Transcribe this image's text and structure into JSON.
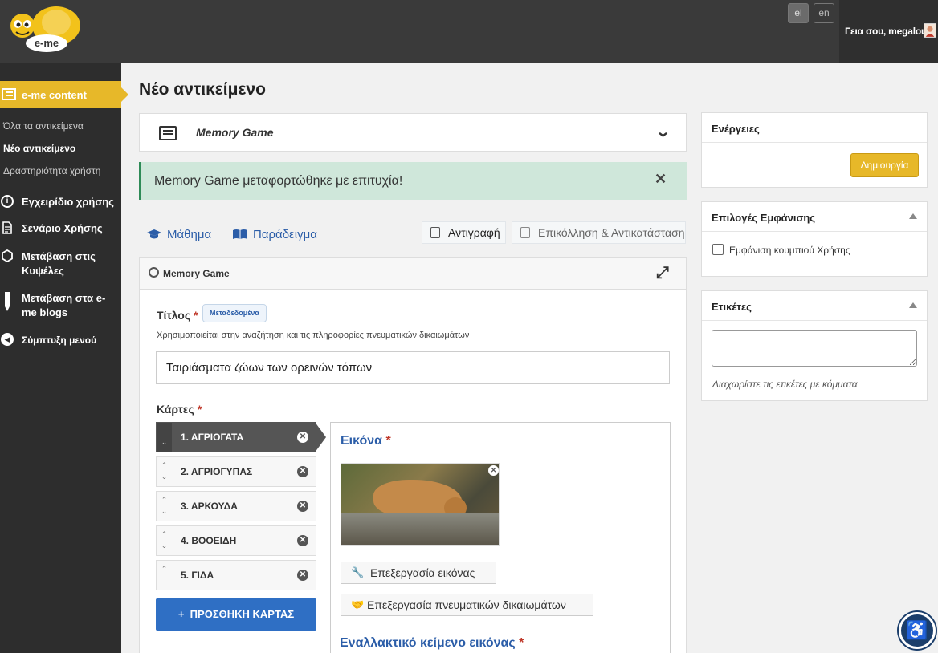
{
  "header": {
    "logo_text": "e-me",
    "lang_el": "el",
    "lang_en": "en",
    "greeting": "Γεια σου, megalou"
  },
  "sidebar": {
    "active_section": "e-me content",
    "sub_items": [
      {
        "label": "Όλα τα αντικείμενα"
      },
      {
        "label": "Νέο αντικείμενο"
      },
      {
        "label": "Δραστηριότητα χρήστη"
      }
    ],
    "items": [
      {
        "label": "Εγχειρίδιο χρήσης"
      },
      {
        "label": "Σενάριο Χρήσης"
      },
      {
        "label": "Μετάβαση στις Κυψέλες"
      },
      {
        "label": "Μετάβαση στα e-me blogs"
      },
      {
        "label": "Σύμπτυξη μενού"
      }
    ]
  },
  "main": {
    "page_title": "Νέο αντικείμενο",
    "content_type": "Memory Game",
    "alert_text": "Memory Game μεταφορτώθηκε με επιτυχία!",
    "tabs": {
      "lesson": "Μάθημα",
      "example": "Παράδειγμα",
      "copy": "Αντιγραφή",
      "paste": "Επικόλληση & Αντικατάσταση"
    },
    "editor": {
      "title": "Memory Game",
      "field_title_label": "Τίτλος",
      "metadata_badge": "Μεταδεδομένα",
      "field_title_help": "Χρησιμοποιείται στην αναζήτηση και τις πληροφορίες πνευματικών δικαιωμάτων",
      "field_title_value": "Ταιριάσματα  ζώων των ορεινών τόπων",
      "cards_label": "Κάρτες",
      "cards": [
        {
          "name": "1. ΑΓΡΙΟΓΑΤΑ"
        },
        {
          "name": "2. ΑΓΡΙΟΓΥΠΑΣ"
        },
        {
          "name": "3. ΑΡΚΟΥΔΑ"
        },
        {
          "name": "4. ΒΟΟΕΙΔΗ"
        },
        {
          "name": "5. ΓΙΔΑ"
        }
      ],
      "add_card": "ΠΡΟΣΘΗΚΗ ΚΑΡΤΑΣ",
      "image_label": "Εικόνα",
      "edit_image": "Επεξεργασία εικόνας",
      "edit_copyright": "Επεξεργασία πνευματικών δικαιωμάτων",
      "alt_text_label": "Εναλλακτικό κείμενο εικόνας"
    }
  },
  "right": {
    "actions_title": "Ενέργειες",
    "create_button": "Δημιουργία",
    "display_title": "Επιλογές Εμφάνισης",
    "display_checkbox": "Εμφάνιση κουμπιού Χρήσης",
    "tags_title": "Ετικέτες",
    "tags_hint": "Διαχωρίστε τις ετικέτες με κόμματα"
  },
  "colors": {
    "accent": "#e7b829",
    "link": "#2b5da8",
    "primary_button": "#2f6fc4",
    "sidebar_bg": "#2d2d2d",
    "success_bg": "#cfe7da"
  }
}
